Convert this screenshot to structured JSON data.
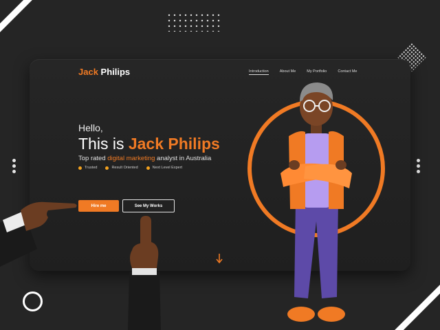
{
  "brand": {
    "first": "Jack",
    "last": "Philips"
  },
  "nav": {
    "items": [
      {
        "label": "Introduction",
        "active": true
      },
      {
        "label": "About Me"
      },
      {
        "label": "My Portfolio"
      },
      {
        "label": "Contact Me"
      }
    ]
  },
  "hero": {
    "greeting": "Hello,",
    "headline_prefix": "This is ",
    "headline_name": "Jack Philips",
    "subtitle_before": "Top rated ",
    "subtitle_highlight": "digital marketing",
    "subtitle_after": " analyst in Australia",
    "features": [
      "Trusted",
      "Result Oriented",
      "Next Level Expert"
    ]
  },
  "buttons": {
    "hire": "Hire me",
    "works": "See My Works"
  },
  "colors": {
    "accent": "#f07a24",
    "bullet": "#f4a21e",
    "background": "#252525",
    "card": "#222222"
  },
  "icons": [
    "scroll-down-arrow-icon",
    "pagination-dots-icon"
  ]
}
